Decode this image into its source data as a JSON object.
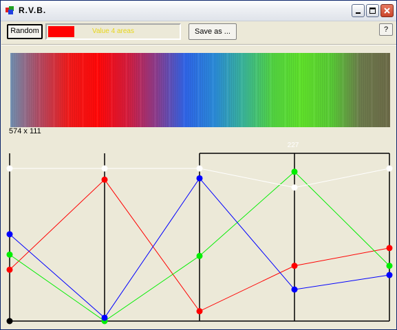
{
  "window": {
    "title": "R.V.B.",
    "icon": "rgb-app-icon"
  },
  "titlebar_buttons": [
    {
      "name": "minimize-button",
      "icon": "minimize-icon"
    },
    {
      "name": "maximize-button",
      "icon": "maximize-icon"
    },
    {
      "name": "close-button",
      "icon": "close-icon"
    }
  ],
  "toolbar": {
    "random_label": "Random",
    "current_color": "#ff0000",
    "value_label": "Value 4 areas",
    "save_label": "Save as ...",
    "help_label": "?"
  },
  "spectrum": {
    "size_label": "574 x 111",
    "stops": [
      "#6f8fb0",
      "#b24a62",
      "#ef1b1b",
      "#ff0808",
      "#d41c3c",
      "#8a3c8c",
      "#2e64e6",
      "#2a8ad6",
      "#3ab496",
      "#52d240",
      "#5fe02a",
      "#58c836",
      "#6c7a4c",
      "#6c6a48"
    ]
  },
  "graph": {
    "columns": 5,
    "value_range": [
      0,
      255
    ],
    "selected_label": "227",
    "series": [
      {
        "name": "red",
        "color": "#ff0000",
        "values": [
          78,
          215,
          15,
          84,
          111
        ]
      },
      {
        "name": "green",
        "color": "#00ee00",
        "values": [
          101,
          0,
          99,
          227,
          84
        ]
      },
      {
        "name": "blue",
        "color": "#0000ff",
        "values": [
          132,
          5,
          217,
          48,
          70
        ]
      },
      {
        "name": "white",
        "color": "#ffffff",
        "values": [
          232,
          232,
          232,
          203,
          232
        ]
      }
    ]
  }
}
